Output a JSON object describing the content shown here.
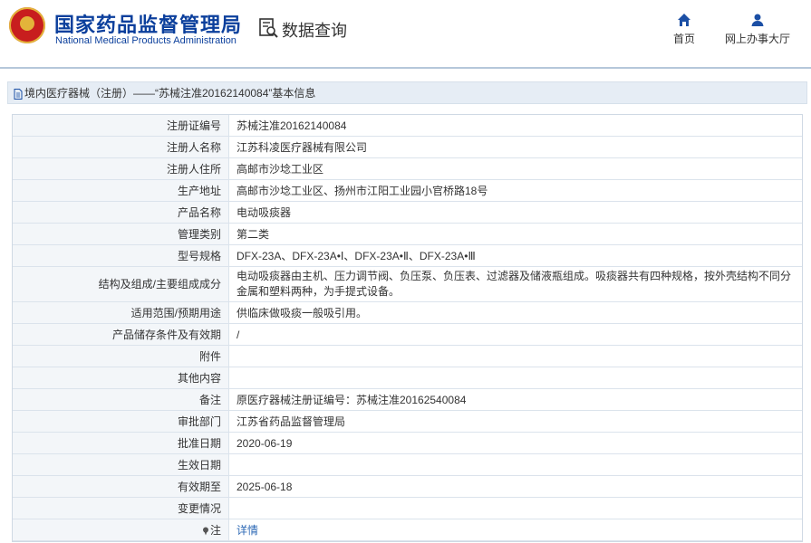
{
  "header": {
    "brand_cn": "国家药品监督管理局",
    "brand_en": "National Medical Products Administration",
    "db_title": "数据查询",
    "nav": [
      {
        "label": "首页",
        "icon": "home-icon"
      },
      {
        "label": "网上办事大厅",
        "icon": "user-icon"
      }
    ]
  },
  "breadcrumb": "境内医疗器械（注册）——“苏械注准20162140084”基本信息",
  "rows": [
    {
      "label": "注册证编号",
      "value": "苏械注准20162140084"
    },
    {
      "label": "注册人名称",
      "value": "江苏科凌医疗器械有限公司"
    },
    {
      "label": "注册人住所",
      "value": "高邮市沙埝工业区"
    },
    {
      "label": "生产地址",
      "value": "高邮市沙埝工业区、扬州市江阳工业园小官桥路18号"
    },
    {
      "label": "产品名称",
      "value": "电动吸痰器"
    },
    {
      "label": "管理类别",
      "value": "第二类"
    },
    {
      "label": "型号规格",
      "value": "DFX-23A、DFX-23A•Ⅰ、DFX-23A•Ⅱ、DFX-23A•Ⅲ"
    },
    {
      "label": "结构及组成/主要组成成分",
      "value": "电动吸痰器由主机、压力调节阀、负压泵、负压表、过滤器及储液瓶组成。吸痰器共有四种规格，按外壳结构不同分金属和塑料两种，为手提式设备。"
    },
    {
      "label": "适用范围/预期用途",
      "value": "供临床做吸痰一般吸引用。"
    },
    {
      "label": "产品储存条件及有效期",
      "value": "/"
    },
    {
      "label": "附件",
      "value": ""
    },
    {
      "label": "其他内容",
      "value": ""
    },
    {
      "label": "备注",
      "value": "原医疗器械注册证编号：苏械注准20162540084"
    },
    {
      "label": "审批部门",
      "value": "江苏省药品监督管理局"
    },
    {
      "label": "批准日期",
      "value": "2020-06-19"
    },
    {
      "label": "生效日期",
      "value": ""
    },
    {
      "label": "有效期至",
      "value": "2025-06-18"
    },
    {
      "label": "变更情况",
      "value": ""
    },
    {
      "label": "注",
      "value": "详情",
      "icon": "note-icon"
    }
  ],
  "colors": {
    "brand": "#0b3f9c",
    "link": "#2c68b5",
    "label_bg": "#f3f6f9",
    "crumb_bg": "#e6edf5"
  }
}
